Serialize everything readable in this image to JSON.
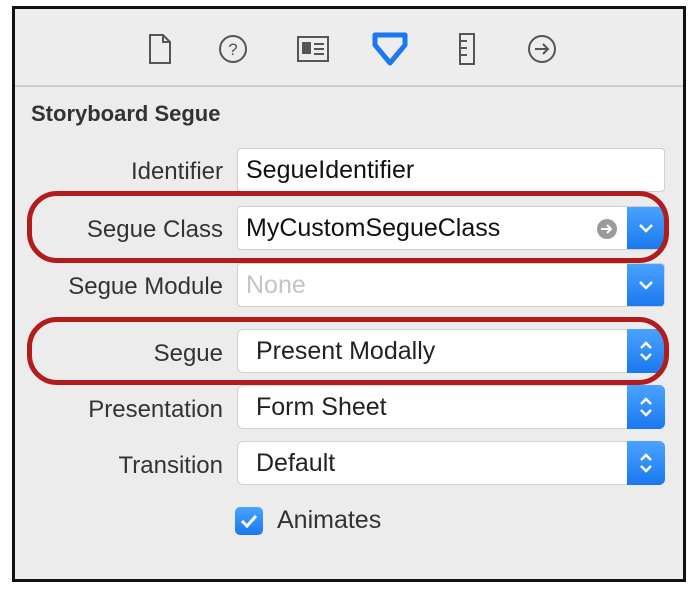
{
  "toolbar": {
    "icons": [
      "file-icon",
      "help-icon",
      "identity-icon",
      "attributes-icon",
      "size-icon",
      "connections-icon"
    ]
  },
  "section": {
    "title": "Storyboard Segue"
  },
  "fields": {
    "identifier": {
      "label": "Identifier",
      "value": "SegueIdentifier"
    },
    "segue_class": {
      "label": "Segue Class",
      "value": "MyCustomSegueClass"
    },
    "segue_module": {
      "label": "Segue Module",
      "placeholder": "None"
    },
    "segue": {
      "label": "Segue",
      "value": "Present Modally"
    },
    "presentation": {
      "label": "Presentation",
      "value": "Form Sheet"
    },
    "transition": {
      "label": "Transition",
      "value": "Default"
    }
  },
  "animates": {
    "label": "Animates",
    "checked": true
  },
  "colors": {
    "accent": "#1a78f0",
    "highlight": "#b31c1c"
  }
}
